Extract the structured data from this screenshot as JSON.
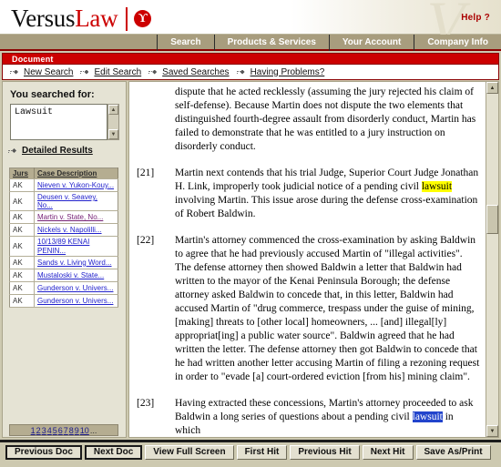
{
  "brand": {
    "name_first": "Versus",
    "name_second": "Law",
    "mark_glyph": "ϒ",
    "ghost_glyph": "V",
    "help_label": "Help ?"
  },
  "mainnav": {
    "items": [
      {
        "label": "Search"
      },
      {
        "label": "Products & Services"
      },
      {
        "label": "Your Account"
      },
      {
        "label": "Company Info"
      }
    ]
  },
  "docbar": {
    "label": "Document"
  },
  "subnav": {
    "items": [
      {
        "label": "New Search",
        "icon": "bullet-arrow-icon"
      },
      {
        "label": "Edit Search",
        "icon": "bullet-arrow-icon"
      },
      {
        "label": "Saved Searches",
        "icon": "bullet-arrow-icon"
      },
      {
        "label": "Having Problems?",
        "icon": "bullet-arrow-icon"
      }
    ]
  },
  "sidebar": {
    "searched_title": "You searched for:",
    "query_value": "Lawsuit",
    "query_placeholder": "",
    "detailed_results_label": "Detailed Results",
    "results": {
      "headers": [
        "Jurs",
        "Case Description"
      ],
      "rows": [
        {
          "jur": "AK",
          "case": "Nieven v. Yukon-Kouy...",
          "visited": false
        },
        {
          "jur": "AK",
          "case": "Deusen v. Seavey, No...",
          "visited": false
        },
        {
          "jur": "AK",
          "case": "Martin v. State, No...",
          "visited": true
        },
        {
          "jur": "AK",
          "case": "Nickels v. Napolilli...",
          "visited": false
        },
        {
          "jur": "AK",
          "case": "10/13/89 KENAI PENIN...",
          "visited": false
        },
        {
          "jur": "AK",
          "case": "Sands v. Living Word...",
          "visited": false
        },
        {
          "jur": "AK",
          "case": "Mustaloski v. State...",
          "visited": false
        },
        {
          "jur": "AK",
          "case": "Gunderson v. Univers...",
          "visited": false
        },
        {
          "jur": "AK",
          "case": "Gunderson v. Univers...",
          "visited": false
        }
      ]
    },
    "pagination": {
      "pages": [
        "1",
        "2",
        "3",
        "4",
        "5",
        "6",
        "7",
        "8",
        "9",
        "10"
      ],
      "more": "..."
    }
  },
  "document": {
    "paragraphs": [
      {
        "num": "",
        "segments": [
          {
            "text": "dispute that he acted recklessly (assuming the jury rejected his claim of self-defense). Because Martin does not dispute the two elements that distinguished fourth-degree assault from disorderly conduct, Martin has failed to demonstrate that he was entitled to a jury instruction on disorderly conduct.",
            "style": "plain"
          }
        ]
      },
      {
        "num": "[21]",
        "segments": [
          {
            "text": "Martin next contends that his trial Judge, Superior Court Judge Jonathan H. Link, improperly took judicial notice of a pending civil ",
            "style": "plain"
          },
          {
            "text": "lawsuit",
            "style": "highlight-yellow"
          },
          {
            "text": " involving Martin. This issue arose during the defense cross-examination of Robert Baldwin.",
            "style": "plain"
          }
        ]
      },
      {
        "num": "[22]",
        "segments": [
          {
            "text": "Martin's attorney commenced the cross-examination by asking Baldwin to agree that he had previously accused Martin of \"illegal activities\". The defense attorney then showed Baldwin a letter that Baldwin had written to the mayor of the Kenai Peninsula Borough; the defense attorney asked Baldwin to concede that, in this letter, Baldwin had accused Martin of \"drug commerce, trespass under the guise of mining, [making] threats to [other local] homeowners, ... [and] illegal[ly] appropriat[ing] a public water source\". Baldwin agreed that he had written the letter. The defense attorney then got Baldwin to concede that he had written another letter accusing Martin of filing a rezoning request in order to \"evade [a] court-ordered eviction [from his] mining claim\".",
            "style": "plain"
          }
        ]
      },
      {
        "num": "[23]",
        "segments": [
          {
            "text": "Having extracted these concessions, Martin's attorney proceeded to ask Baldwin a long series of questions about a pending civil ",
            "style": "plain"
          },
          {
            "text": "lawsuit",
            "style": "highlight-blue"
          },
          {
            "text": " in which",
            "style": "plain"
          }
        ]
      }
    ],
    "scrollbar": {
      "up_glyph": "▲",
      "down_glyph": "▼"
    }
  },
  "toolbar": {
    "buttons": [
      {
        "label": "Previous Doc",
        "emphasized": true
      },
      {
        "label": "Next Doc",
        "emphasized": true
      },
      {
        "label": "View Full Screen",
        "emphasized": false
      },
      {
        "label": "First Hit",
        "emphasized": false
      },
      {
        "label": "Previous Hit",
        "emphasized": false
      },
      {
        "label": "Next Hit",
        "emphasized": false
      },
      {
        "label": "Save As/Print",
        "emphasized": false
      }
    ]
  },
  "colors": {
    "brand_red": "#cc0000",
    "nav_tan": "#a89d7e",
    "page_tan": "#cdc9b0",
    "panel_cream": "#e5e3d4",
    "link_blue": "#2222cc",
    "link_visited": "#772277",
    "highlight_yellow": "#ffff00",
    "selection_blue": "#2244cc"
  }
}
